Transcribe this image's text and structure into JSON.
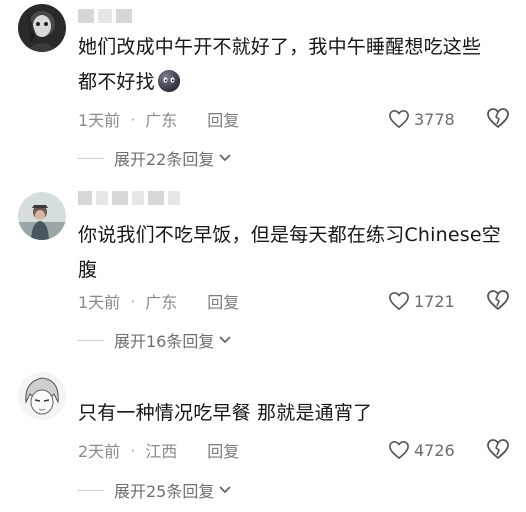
{
  "comments": [
    {
      "text_line1": "她们改成中午开不就好了，我中午睡醒想吃这些",
      "text_line2": "都不好找",
      "emoji": "ghost-face-emoji",
      "time": "1天前",
      "location": "广东",
      "reply_label": "回复",
      "likes": "3778",
      "expand_label": "展开22条回复"
    },
    {
      "text_line1": "你说我们不吃早饭，但是每天都在练习Chinese空",
      "text_line2": "腹",
      "time": "1天前",
      "location": "广东",
      "reply_label": "回复",
      "likes": "1721",
      "expand_label": "展开16条回复"
    },
    {
      "text_line1": "只有一种情况吃早餐 那就是通宵了",
      "time": "2天前",
      "location": "江西",
      "reply_label": "回复",
      "likes": "4726",
      "expand_label": "展开25条回复"
    }
  ],
  "icons": {
    "like": "heart-outline-icon",
    "dislike": "broken-heart-icon",
    "expand": "chevron-down-icon"
  }
}
